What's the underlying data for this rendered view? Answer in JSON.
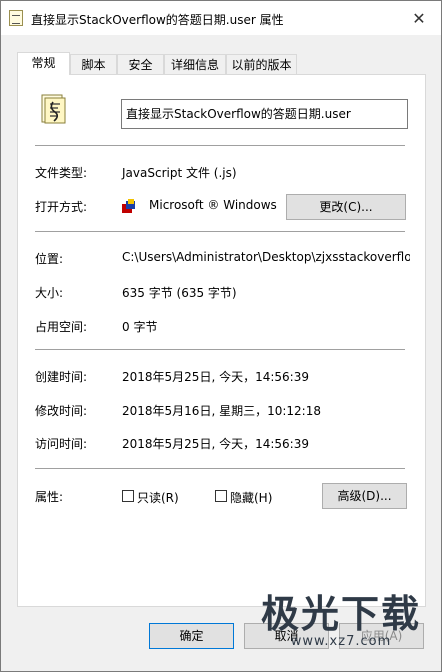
{
  "window": {
    "title": "直接显示StackOverflow的答题日期.user 属性",
    "close_glyph": "✕"
  },
  "tabs": [
    {
      "label": "常规",
      "active": true
    },
    {
      "label": "脚本"
    },
    {
      "label": "安全"
    },
    {
      "label": "详细信息"
    },
    {
      "label": "以前的版本"
    }
  ],
  "general": {
    "file_name": "直接显示StackOverflow的答题日期.user",
    "file_type_label": "文件类型:",
    "file_type_value": "JavaScript 文件 (.js)",
    "opens_with_label": "打开方式:",
    "opens_with_value": "Microsoft ® Windows",
    "change_button": "更改(C)...",
    "location_label": "位置:",
    "location_value": "C:\\Users\\Administrator\\Desktop\\zjxsstackoverflow",
    "size_label": "大小:",
    "size_value": "635 字节 (635 字节)",
    "disk_size_label": "占用空间:",
    "disk_size_value": "0 字节",
    "created_label": "创建时间:",
    "created_value": "2018年5月25日, 今天，14:56:39",
    "modified_label": "修改时间:",
    "modified_value": "2018年5月16日, 星期三，10:12:18",
    "accessed_label": "访问时间:",
    "accessed_value": "2018年5月25日, 今天，14:56:39",
    "attributes_label": "属性:",
    "readonly_label": "只读(R)",
    "hidden_label": "隐藏(H)",
    "advanced_button": "高级(D)..."
  },
  "footer": {
    "ok_button": "确定",
    "cancel_button": "取消",
    "apply_button": "应用(A)"
  },
  "watermark": {
    "big": "极光下载",
    "small": "www.xz7.com"
  },
  "colors": {
    "accent": "#0078d7",
    "watermark": "#2f3a47"
  }
}
